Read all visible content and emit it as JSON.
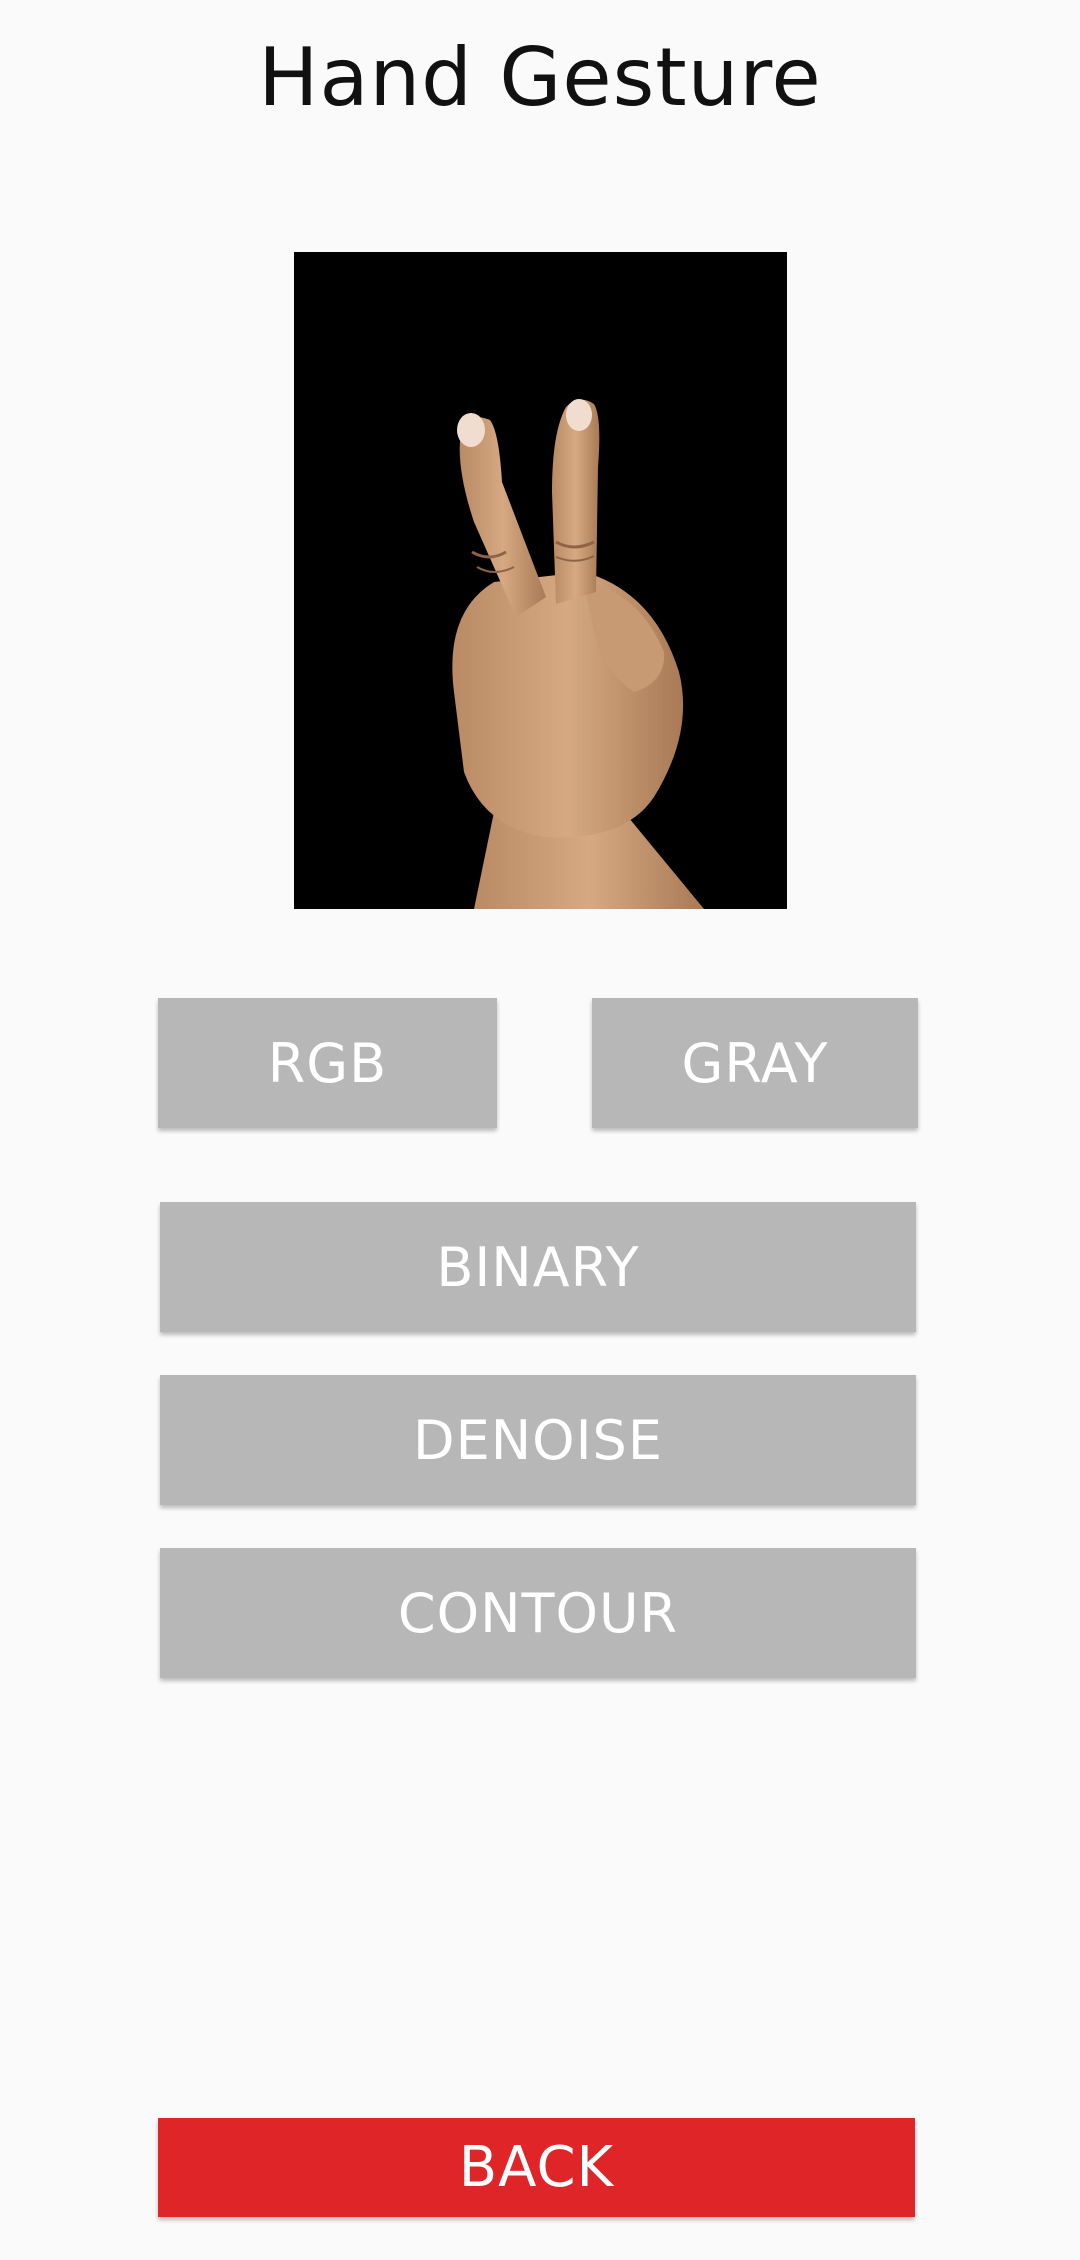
{
  "header": {
    "title": "Hand Gesture"
  },
  "preview": {
    "icon": "hand-gesture-image",
    "background_color": "#000000"
  },
  "buttons": {
    "rgb_label": "RGB",
    "gray_label": "GRAY",
    "binary_label": "BINARY",
    "denoise_label": "DENOISE",
    "contour_label": "CONTOUR",
    "back_label": "BACK"
  },
  "colors": {
    "background": "#fafafa",
    "button_gray": "#b7b7b7",
    "back_red": "#e02528",
    "button_text": "#ffffff"
  }
}
